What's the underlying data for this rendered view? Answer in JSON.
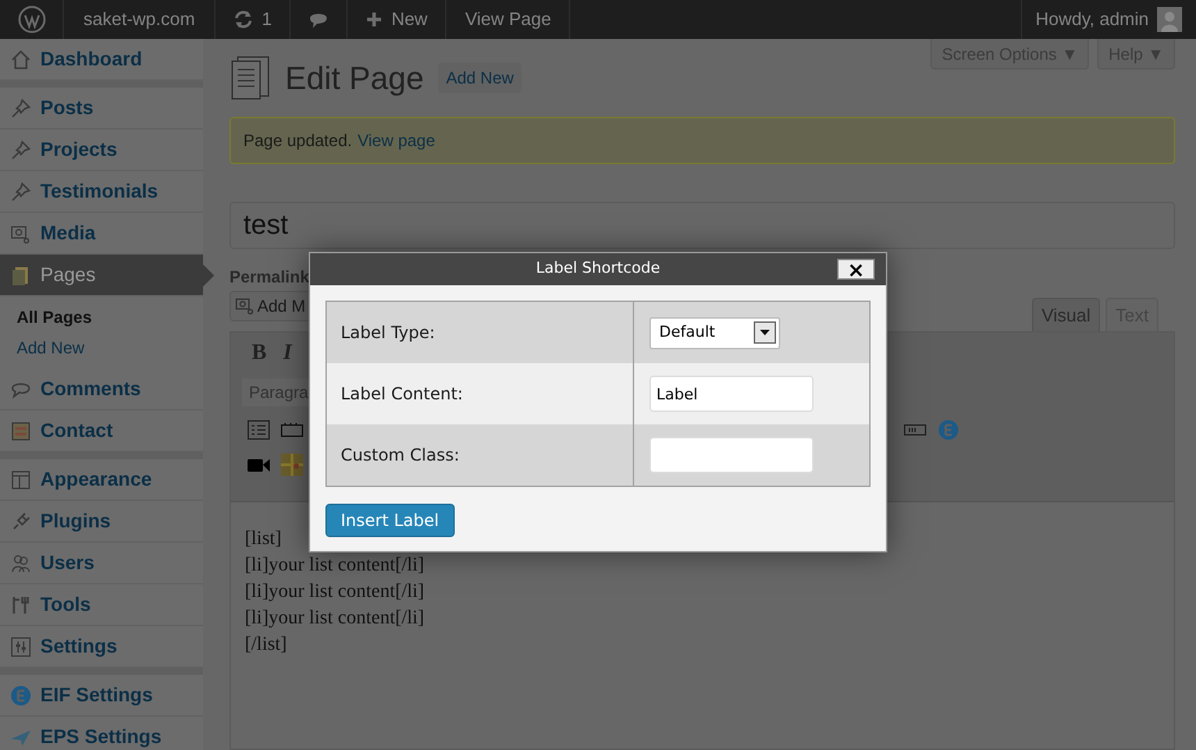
{
  "admin_bar": {
    "site": "saket-wp.com",
    "updates": "1",
    "new": "New",
    "view": "View Page",
    "greeting": "Howdy, admin"
  },
  "sidebar": {
    "groups": [
      {
        "items": [
          {
            "label": "Dashboard",
            "selected": false
          }
        ]
      },
      {
        "items": [
          {
            "label": "Posts",
            "selected": false
          },
          {
            "label": "Projects",
            "selected": false
          },
          {
            "label": "Testimonials",
            "selected": false
          },
          {
            "label": "Media",
            "selected": false
          },
          {
            "label": "Pages",
            "selected": true,
            "children": [
              {
                "label": "All Pages",
                "selected": true
              },
              {
                "label": "Add New",
                "selected": false
              }
            ]
          },
          {
            "label": "Comments",
            "selected": false
          },
          {
            "label": "Contact",
            "selected": false
          }
        ]
      },
      {
        "items": [
          {
            "label": "Appearance",
            "selected": false
          },
          {
            "label": "Plugins",
            "selected": false
          },
          {
            "label": "Users",
            "selected": false
          },
          {
            "label": "Tools",
            "selected": false
          },
          {
            "label": "Settings",
            "selected": false
          }
        ]
      },
      {
        "items": [
          {
            "label": "EIF Settings",
            "selected": false
          },
          {
            "label": "EPS Settings",
            "selected": false
          }
        ]
      }
    ]
  },
  "screen_tabs": [
    "Screen Options ▼",
    "Help ▼"
  ],
  "heading": {
    "title": "Edit Page",
    "add_new": "Add New"
  },
  "notice": {
    "text": "Page updated.",
    "link": "View page"
  },
  "post_title": "test",
  "permalink": "Permalink",
  "add_media": "Add M",
  "editor_tabs": [
    {
      "label": "Visual",
      "selected": true
    },
    {
      "label": "Text",
      "selected": false
    }
  ],
  "toolbar": {
    "bold": "B",
    "italic": "I",
    "format": "Paragra"
  },
  "content": [
    "[list]",
    "[li]your list content[/li]",
    "[li]your list content[/li]",
    "[li]your list content[/li]",
    "[/list]"
  ],
  "dialog": {
    "title": "Label Shortcode",
    "close": "×",
    "rows": [
      {
        "label": "Label Type:",
        "kind": "select",
        "value": "Default"
      },
      {
        "label": "Label Content:",
        "kind": "text",
        "value": "Label"
      },
      {
        "label": "Custom Class:",
        "kind": "text",
        "value": ""
      }
    ],
    "button": "Insert Label"
  }
}
